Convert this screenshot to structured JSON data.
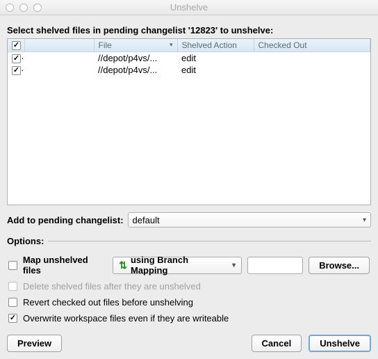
{
  "window": {
    "title": "Unshelve"
  },
  "instruction": "Select shelved files in pending changelist '12823' to unshelve:",
  "table": {
    "headers": {
      "check": "✓",
      "icon": "",
      "file": "File",
      "action": "Shelved Action",
      "checkedOut": "Checked Out"
    },
    "rows": [
      {
        "checked": true,
        "file": "//depot/p4vs/...",
        "action": "edit",
        "checkedOut": ""
      },
      {
        "checked": true,
        "file": "//depot/p4vs/...",
        "action": "edit",
        "checkedOut": ""
      }
    ]
  },
  "addTo": {
    "label": "Add to pending changelist:",
    "value": "default"
  },
  "options": {
    "label": "Options:",
    "map": {
      "label": "Map unshelved files",
      "method": "using Branch Mapping",
      "valuePlaceholder": "",
      "browse": "Browse..."
    },
    "deleteAfter": {
      "label": "Delete shelved files after they are unshelved",
      "checked": false,
      "disabled": true
    },
    "revert": {
      "label": "Revert checked out files before unshelving",
      "checked": false
    },
    "overwrite": {
      "label": "Overwrite workspace files even if they are writeable",
      "checked": true
    }
  },
  "buttons": {
    "preview": "Preview",
    "cancel": "Cancel",
    "unshelve": "Unshelve"
  }
}
